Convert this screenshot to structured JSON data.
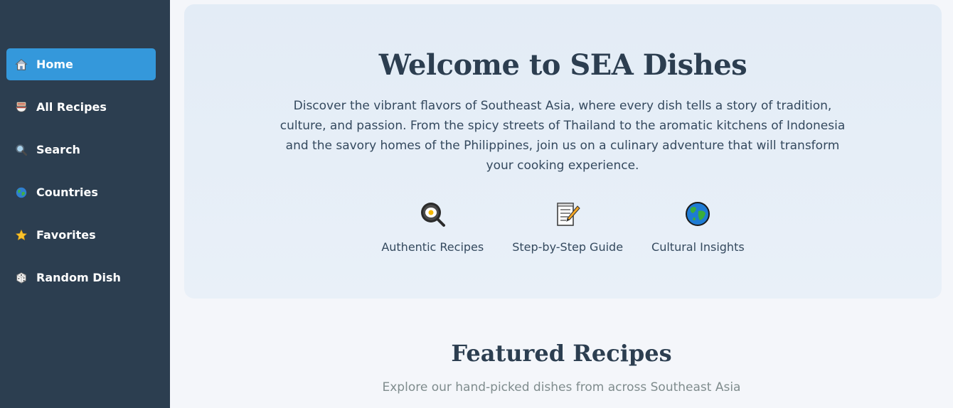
{
  "sidebar": {
    "items": [
      {
        "label": "Home",
        "icon": "house-icon",
        "active": true
      },
      {
        "label": "All Recipes",
        "icon": "noodle-bowl-icon",
        "active": false
      },
      {
        "label": "Search",
        "icon": "magnifier-icon",
        "active": false
      },
      {
        "label": "Countries",
        "icon": "globe-icon",
        "active": false
      },
      {
        "label": "Favorites",
        "icon": "star-icon",
        "active": false
      },
      {
        "label": "Random Dish",
        "icon": "dice-icon",
        "active": false
      }
    ]
  },
  "hero": {
    "title": "Welcome to SEA Dishes",
    "description": "Discover the vibrant flavors of Southeast Asia, where every dish tells a story of tradition, culture, and passion. From the spicy streets of Thailand to the aromatic kitchens of Indonesia and the savory homes of the Philippines, join us on a culinary adventure that will transform your cooking experience.",
    "features": [
      {
        "label": "Authentic Recipes",
        "icon": "frying-pan-icon"
      },
      {
        "label": "Step-by-Step Guide",
        "icon": "memo-icon"
      },
      {
        "label": "Cultural Insights",
        "icon": "globe-icon"
      }
    ]
  },
  "featured": {
    "title": "Featured Recipes",
    "subtitle": "Explore our hand-picked dishes from across Southeast Asia"
  },
  "colors": {
    "sidebar_bg": "#2c3e50",
    "active_item": "#3498db",
    "heading": "#2c3e50",
    "body_text": "#34495e",
    "muted_text": "#7f8c8d"
  }
}
